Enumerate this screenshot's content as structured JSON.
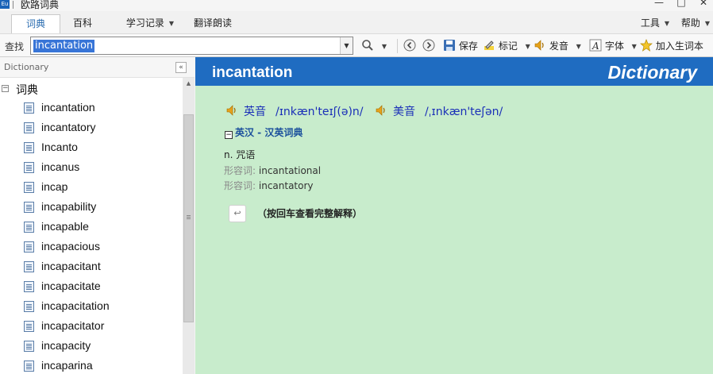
{
  "window": {
    "title": "欧路词典",
    "app_icon": "Eu",
    "minimize": "—",
    "maximize": "□",
    "close": "✕"
  },
  "menu": {
    "tabs": [
      {
        "label": "词典",
        "active": true
      },
      {
        "label": "百科"
      },
      {
        "label": "学习记录"
      },
      {
        "label": "翻译朗读"
      }
    ],
    "right": [
      {
        "label": "工具"
      },
      {
        "label": "帮助"
      }
    ]
  },
  "toolbar": {
    "search_label": "查找",
    "search_value": "incantation",
    "save_label": "保存",
    "mark_label": "标记",
    "pronounce_label": "发音",
    "font_label": "字体",
    "add_wordbook_label": "加入生词本"
  },
  "sidebar": {
    "title": "Dictionary",
    "collapse": "«",
    "tree_root": "词典",
    "tree_toggle": "−",
    "items": [
      "incantation",
      "incantatory",
      "Incanto",
      "incanus",
      "incap",
      "incapability",
      "incapable",
      "incapacious",
      "incapacitant",
      "incapacitate",
      "incapacitation",
      "incapacitator",
      "incapacity",
      "incaparina"
    ]
  },
  "entry": {
    "word": "incantation",
    "brand": "Dictionary",
    "uk_label": "英音",
    "uk_phonetic": "/ɪnkæn'teɪʃ(ə)n/",
    "us_label": "美音",
    "us_phonetic": "/ˌɪnkæn'teʃən/",
    "section_toggle": "−",
    "section_title": "英汉 - 汉英词典",
    "pos": "n.",
    "meaning": "咒语",
    "derivatives": [
      {
        "label": "形容词:",
        "value": "incantational"
      },
      {
        "label": "形容词:",
        "value": "incantatory"
      }
    ],
    "enter_icon": "↩",
    "enter_hint": "（按回车查看完整解释）"
  },
  "colors": {
    "header_blue": "#1f6cc1",
    "content_green": "#c8eccc",
    "phonetic_blue": "#1a2fb8",
    "selection_blue": "#3875d7"
  }
}
